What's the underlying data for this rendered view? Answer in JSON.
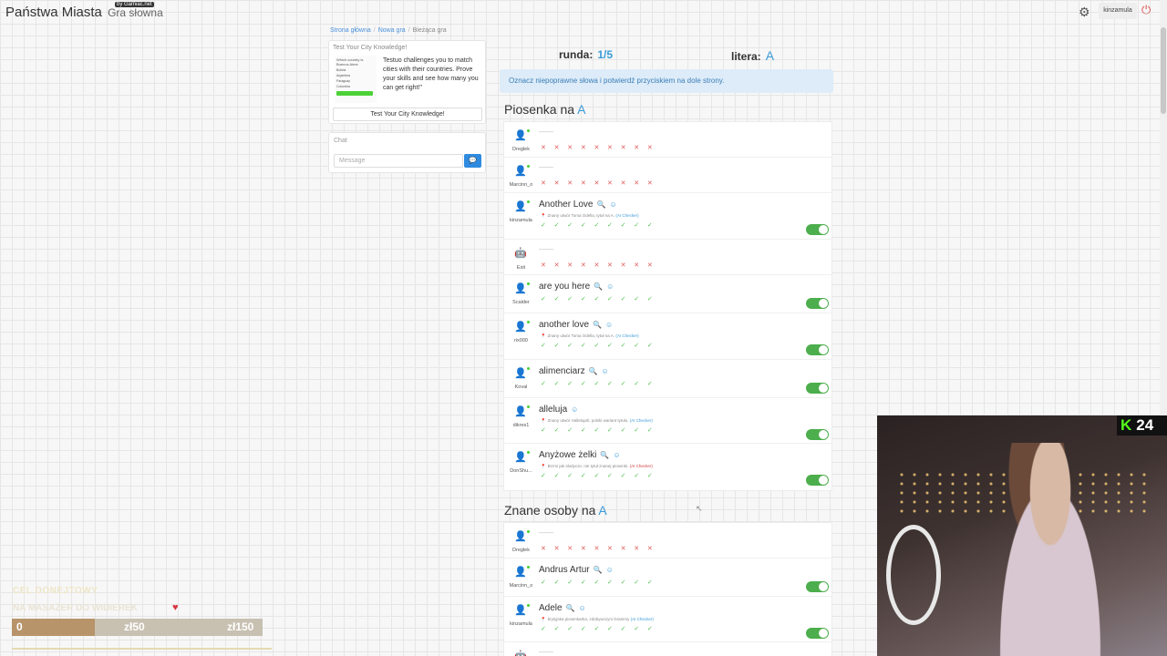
{
  "app": {
    "title": "Państwa Miasta",
    "subtitle": "Gra słowna",
    "by": "by Gamiac.net"
  },
  "header": {
    "username": "kinzamula",
    "gear_icon": "gear-icon",
    "power_icon": "power-icon"
  },
  "breadcrumb": {
    "home": "Strona główna",
    "new_game": "Nowa gra",
    "current": "Bieżąca gra"
  },
  "promo": {
    "title": "Test Your City Knowledge!",
    "image_question": "Which country is Buenos Aires",
    "image_options": [
      "Bolivia",
      "Argentina",
      "Paraguay",
      "Colombia"
    ],
    "text": "Testuo challenges you to match cities with their countries. Prove your skills and see how many you can get right!\"",
    "button": "Test Your City Knowledge!"
  },
  "chat": {
    "title": "Chat",
    "placeholder": "Message"
  },
  "game": {
    "round_label": "runda:",
    "round_value": "1/5",
    "letter_label": "litera:",
    "letter_value": "A",
    "info": "Oznacz niepoprawne słowa i potwierdź przyciskiem na dole strony."
  },
  "categories": [
    {
      "name": "Piosenka na",
      "letter": "A",
      "answers": [
        {
          "user": "Dreglek",
          "word": "——",
          "valid": false
        },
        {
          "user": "Marcinn_o",
          "word": "——",
          "valid": false
        },
        {
          "user": "kinzamula",
          "word": "Another Love",
          "note": "Znany utwór Toma Odella, tytuł na A.",
          "checker": "(AI Checker)",
          "valid": true
        },
        {
          "user": "Exit",
          "word": "——",
          "valid": false,
          "bot": true
        },
        {
          "user": "Scalder",
          "word": "are you here",
          "valid": true
        },
        {
          "user": "rix000",
          "word": "another love",
          "note": "Znany utwór Toma Odella, tytuł na A.",
          "checker": "(AI Checker)",
          "valid": true
        },
        {
          "user": "Koval",
          "word": "alimenciarz",
          "valid": true
        },
        {
          "user": "dikres1",
          "word": "alleluja",
          "note": "Znany utwór Hallelujah; polski wariant tytułu.",
          "checker": "(AI Checker)",
          "valid": true
        },
        {
          "user": "DonShu...",
          "word": "Anyżowe żelki",
          "note": "Brzmi jak słodycze, nie tytuł znanej piosenki.",
          "checker": "(AI Checker)",
          "checker_negative": true,
          "valid": true
        }
      ]
    },
    {
      "name": "Znane osoby na",
      "letter": "A",
      "answers": [
        {
          "user": "Dreglek",
          "word": "——",
          "valid": false
        },
        {
          "user": "Marcinn_o",
          "word": "Andrus Artur",
          "valid": true
        },
        {
          "user": "kinzamula",
          "word": "Adele",
          "note": "brytyjska piosenkarka, zdobywczyni Grammy",
          "checker": "(AI Checker)",
          "valid": true
        },
        {
          "user": "",
          "word": "——",
          "valid": false,
          "bot": true
        }
      ]
    }
  ],
  "marks": {
    "wrong": "✕ ✕ ✕ ✕ ✕ ✕ ✕ ✕ ✕",
    "right": "✓ ✓ ✓ ✓ ✓ ✓ ✓ ✓ ✓"
  },
  "donation": {
    "title": "CEL DONEJTOWY",
    "subtitle": "NA MASAŻER DO WIDIEREK",
    "current": "0",
    "mid": "zł50",
    "goal": "zł150",
    "progress": 0.33
  },
  "stream": {
    "viewers": "24"
  }
}
